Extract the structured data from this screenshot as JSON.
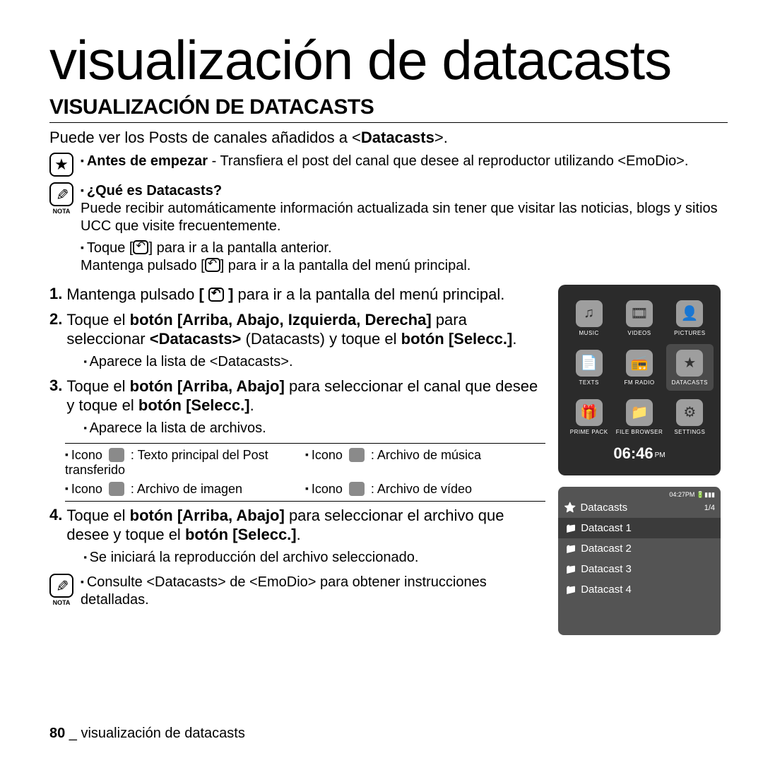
{
  "page_title": "visualización de datacasts",
  "section_title": "VISUALIZACIÓN DE DATACASTS",
  "intro_pre": "Puede ver los Posts de canales añadidos a <",
  "intro_bold": "Datacasts",
  "intro_post": ">.",
  "star_note": {
    "bold": "Antes de empezar",
    "rest": " - Transfiera el post del canal que desee al reproductor utilizando <EmoDio>."
  },
  "nota_label": "NOTA",
  "que_es": {
    "title": "¿Qué es Datacasts?",
    "body": "Puede recibir automáticamente información actualizada sin tener que visitar las noticias, blogs y sitios UCC que visite frecuentemente."
  },
  "toque_prev_a": "Toque [",
  "toque_prev_b": "] para ir a la pantalla anterior.",
  "mantenga_a": "Mantenga pulsado [",
  "mantenga_b": "] para ir a la pantalla del menú principal.",
  "steps": {
    "s1_a": "Mantenga pulsado ",
    "s1_b": " para ir a la pantalla del menú principal.",
    "s2_a": "Toque el ",
    "s2_b": "botón [Arriba, Abajo, Izquierda, Derecha]",
    "s2_c": " para seleccionar ",
    "s2_d": "<Datacasts>",
    "s2_e": " (Datacasts) y toque el ",
    "s2_f": "botón [Selecc.]",
    "s2_g": ".",
    "s2_sub": "Aparece la lista de <Datacasts>.",
    "s3_a": "Toque el ",
    "s3_b": "botón [Arriba, Abajo]",
    "s3_c": " para seleccionar el canal que desee y toque el ",
    "s3_d": "botón [Selecc.]",
    "s3_e": ".",
    "s3_sub": "Aparece la lista de archivos.",
    "s4_a": "Toque el ",
    "s4_b": "botón [Arriba, Abajo]",
    "s4_c": " para seleccionar el archivo que desee y toque el ",
    "s4_d": "botón [Selecc.]",
    "s4_e": ".",
    "s4_sub": "Se iniciará la reproducción del archivo seleccionado."
  },
  "icons": {
    "a": "Icono ",
    "a2": " : Texto principal del Post transferido",
    "b": "Icono ",
    "b2": " : Archivo de imagen",
    "c": "Icono ",
    "c2": " : Archivo de música",
    "d": "Icono ",
    "d2": " : Archivo de vídeo"
  },
  "bottom_note": "Consulte <Datacasts> de <EmoDio> para obtener instrucciones detalladas.",
  "footer_num": "80",
  "footer_text": " _ visualización de datacasts",
  "device1": {
    "items": [
      "MUSIC",
      "VIDEOS",
      "PICTURES",
      "TEXTS",
      "FM RADIO",
      "DATACASTS",
      "PRIME PACK",
      "FILE BROWSER",
      "SETTINGS"
    ],
    "hl": 5,
    "icons": [
      "♫",
      "🎞",
      "👤",
      "📄",
      "📻",
      "★",
      "🎁",
      "📁",
      "⚙"
    ],
    "clock": "06:46",
    "ampm": "PM"
  },
  "device2": {
    "time": "04:27PM 🔋▮▮▮",
    "title": "Datacasts",
    "count": "1/4",
    "rows": [
      "Datacast 1",
      "Datacast 2",
      "Datacast 3",
      "Datacast 4"
    ]
  }
}
